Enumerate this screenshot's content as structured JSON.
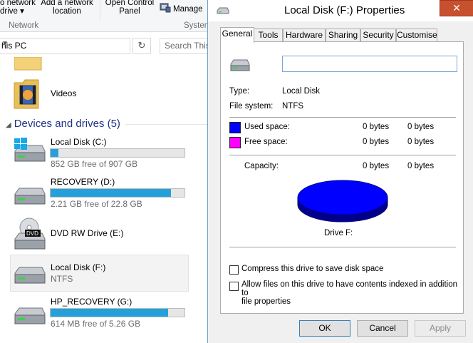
{
  "ribbon": {
    "map_drive_line1": "o network",
    "map_drive_line2": "drive ▾",
    "add_location_line1": "Add a network",
    "add_location_line2": "location",
    "open_cp_line1": "Open Control",
    "open_cp_line2": "Panel",
    "manage": "Manage",
    "group_network": "Network",
    "group_system": "System"
  },
  "address_bar": {
    "path": "his PC",
    "search_placeholder": "Search This"
  },
  "folders": [
    {
      "name": "Videos"
    }
  ],
  "devices_section": {
    "title": "Devices and drives (5)"
  },
  "drives": [
    {
      "name": "Local Disk (C:)",
      "detail": "852 GB free of 907 GB",
      "used_fraction": 0.06
    },
    {
      "name": "RECOVERY (D:)",
      "detail": "2.21 GB free of 22.8 GB",
      "used_fraction": 0.9
    },
    {
      "name": "DVD RW Drive (E:)"
    },
    {
      "name": "Local Disk (F:)",
      "detail": "NTFS"
    },
    {
      "name": "HP_RECOVERY (G:)",
      "detail": "614 MB free of 5.26 GB",
      "used_fraction": 0.88
    }
  ],
  "dialog": {
    "title": "Local Disk (F:) Properties",
    "close": "✕",
    "tabs": [
      "General",
      "Tools",
      "Hardware",
      "Sharing",
      "Security",
      "Customise"
    ],
    "volume_label": "",
    "type_label": "Type:",
    "type_value": "Local Disk",
    "fs_label": "File system:",
    "fs_value": "NTFS",
    "used_label": "Used space:",
    "used_bytes": "0 bytes",
    "used_size": "0 bytes",
    "free_label": "Free space:",
    "free_bytes": "0 bytes",
    "free_size": "0 bytes",
    "capacity_label": "Capacity:",
    "capacity_bytes": "0 bytes",
    "capacity_size": "0 bytes",
    "drive_caption": "Drive F:",
    "compress_label": "Compress this drive to save disk space",
    "index_label_line1": "Allow files on this drive to have contents indexed in addition to",
    "index_label_line2": "file properties",
    "ok": "OK",
    "cancel": "Cancel",
    "apply": "Apply",
    "used_color": "#0000ff",
    "free_color": "#ff00ff"
  }
}
